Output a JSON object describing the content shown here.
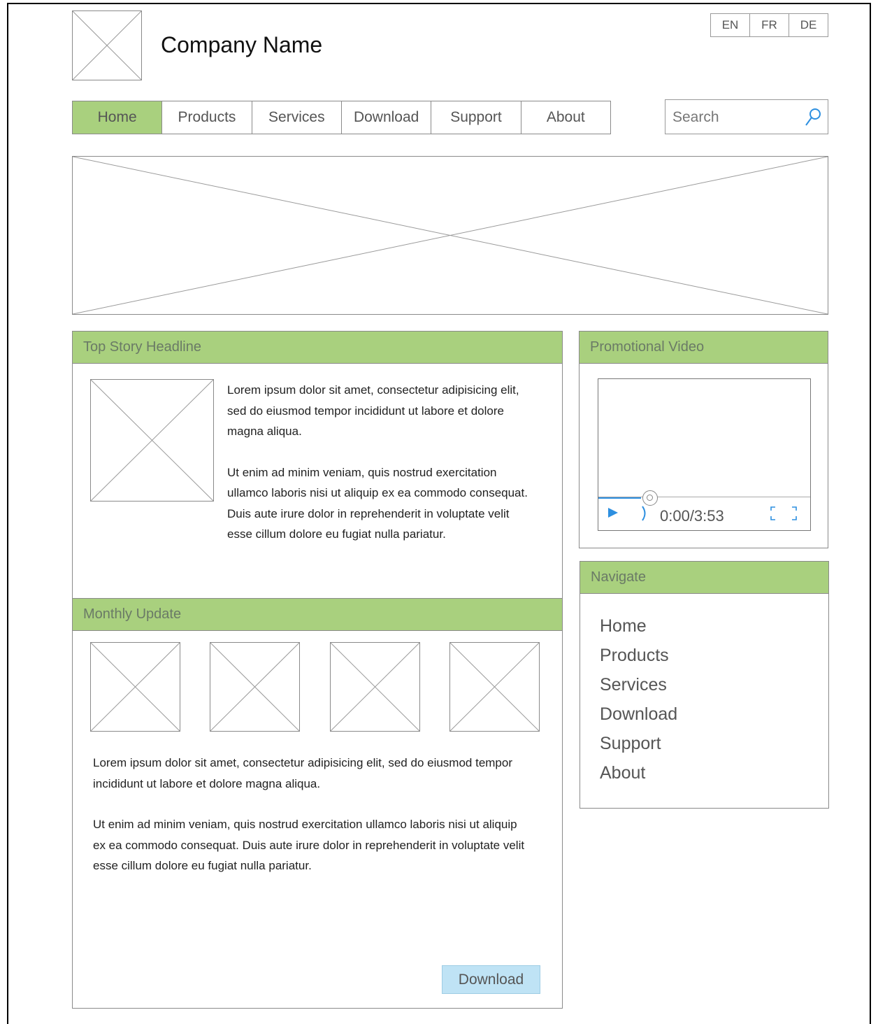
{
  "header": {
    "company_name": "Company Name",
    "languages": [
      "EN",
      "FR",
      "DE"
    ]
  },
  "nav": {
    "items": [
      "Home",
      "Products",
      "Services",
      "Download",
      "Support",
      "About"
    ],
    "active": "Home"
  },
  "search": {
    "placeholder": "Search",
    "icon": "search-icon"
  },
  "top_story": {
    "title": "Top Story Headline",
    "para1": "Lorem ipsum dolor sit amet, consectetur adipisicing elit, sed do eiusmod tempor incididunt ut labore et dolore magna aliqua.",
    "para2": "Ut enim ad minim veniam, quis nostrud exercitation ullamco laboris nisi ut aliquip ex ea commodo consequat. Duis aute irure dolor in reprehenderit in voluptate velit esse cillum dolore eu fugiat nulla pariatur."
  },
  "monthly_update": {
    "title": "Monthly Update",
    "para1": "Lorem ipsum dolor sit amet, consectetur adipisicing elit, sed do eiusmod tempor incididunt ut labore et dolore magna aliqua.",
    "para2": "Ut enim ad minim veniam, quis nostrud exercitation ullamco laboris nisi ut aliquip ex ea commodo consequat. Duis aute irure dolor in reprehenderit in voluptate velit esse cillum dolore eu fugiat nulla pariatur.",
    "download_label": "Download"
  },
  "promo_video": {
    "title": "Promotional Video",
    "time": "0:00/3:53",
    "played_fraction": 0.2
  },
  "navigate": {
    "title": "Navigate",
    "links": [
      "Home",
      "Products",
      "Services",
      "Download",
      "Support",
      "About"
    ]
  },
  "colors": {
    "accent_green": "#a9d07e",
    "button_blue": "#bfe3f5",
    "progress_blue": "#2d8fe0"
  }
}
